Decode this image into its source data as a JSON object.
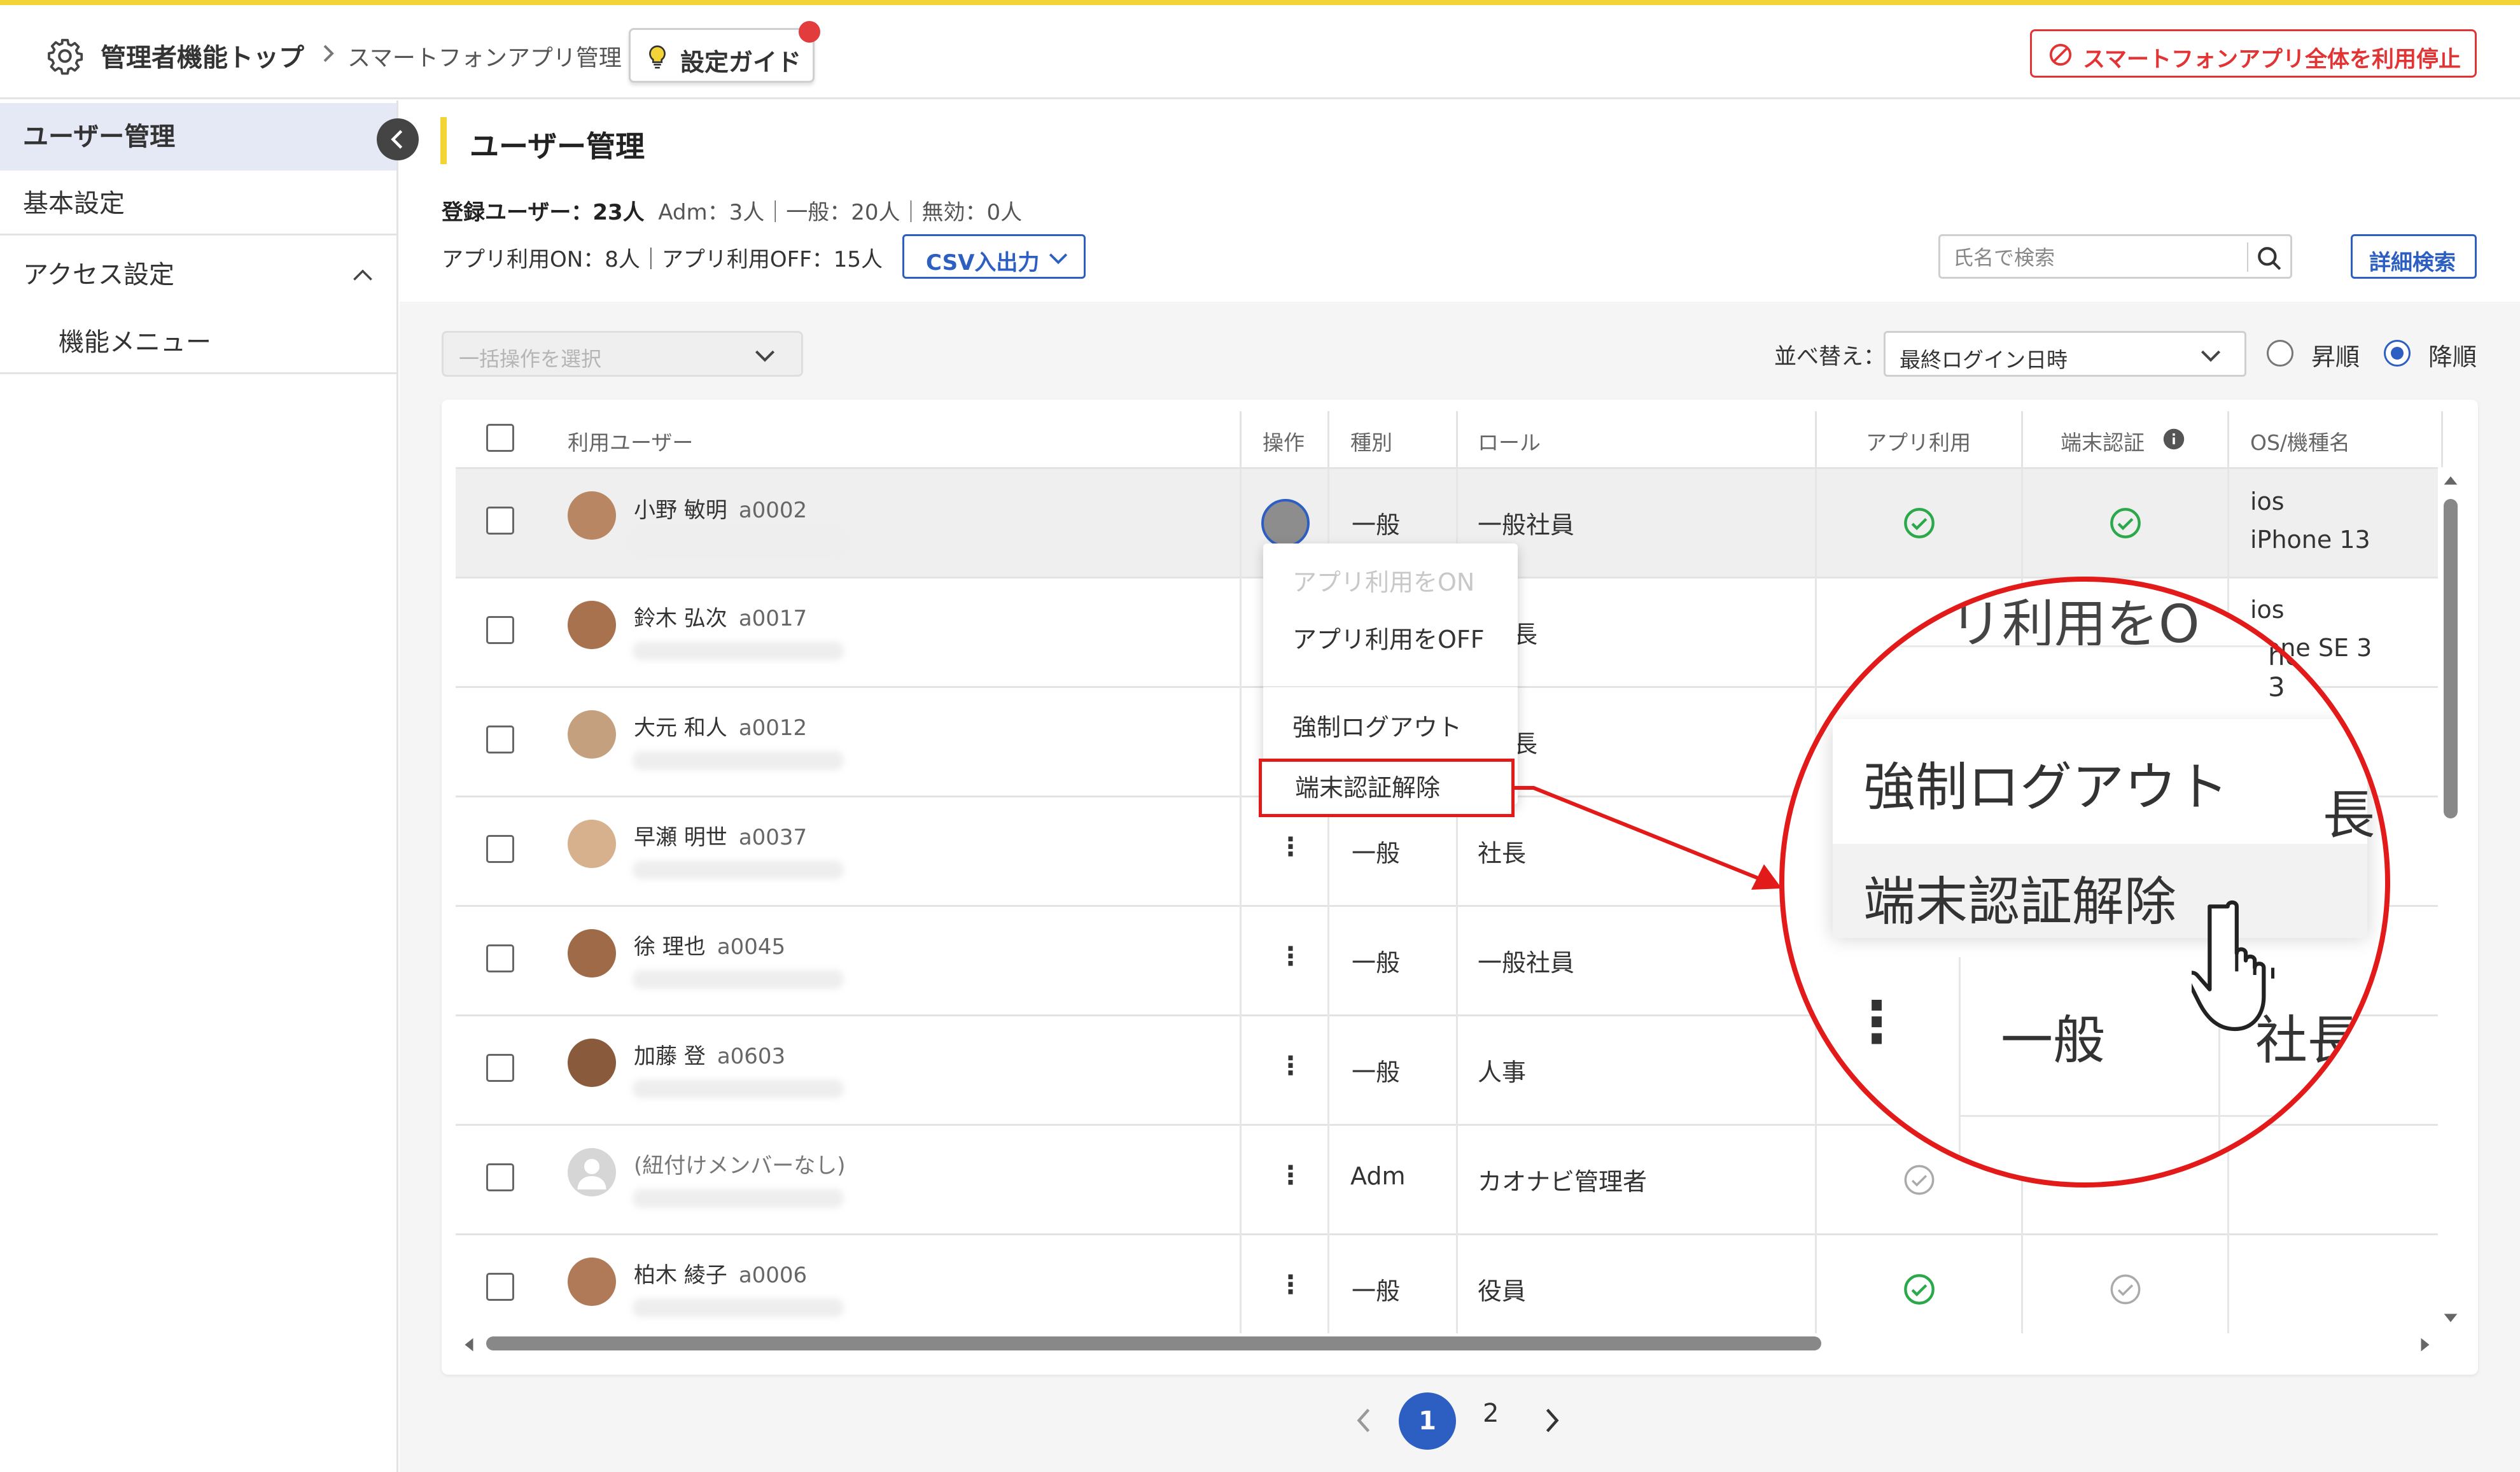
{
  "header": {
    "admin_top": "管理者機能トップ",
    "current_page": "スマートフォンアプリ管理",
    "guide_button": "設定ガイド",
    "stop_button": "スマートフォンアプリ全体を利用停止"
  },
  "sidebar": {
    "user_mgmt": "ユーザー管理",
    "basic_settings": "基本設定",
    "access_settings": "アクセス設定",
    "function_menu": "機能メニュー"
  },
  "main": {
    "title": "ユーザー管理",
    "stats_registered_label": "登録ユーザー：23人",
    "stats_detail": "Adm：3人｜一般：20人｜無効：0人",
    "stats_app": "アプリ利用ON：8人｜アプリ利用OFF：15人",
    "csv_button": "CSV入出力",
    "search_placeholder": "氏名で検索",
    "advanced_search": "詳細検索",
    "bulk_placeholder": "一括操作を選択",
    "sort_label": "並べ替え：",
    "sort_value": "最終ログイン日時",
    "asc": "昇順",
    "desc": "降順"
  },
  "table": {
    "headers": {
      "user": "利用ユーザー",
      "action": "操作",
      "type": "種別",
      "role": "ロール",
      "app_use": "アプリ利用",
      "device_auth": "端末認証",
      "os": "OS/機種名"
    },
    "rows": [
      {
        "name": "小野 敏明",
        "id": "a0002",
        "type": "一般",
        "role": "一般社員",
        "os1": "ios",
        "os2": "iPhone 13"
      },
      {
        "name": "鈴木 弘次",
        "id": "a0017",
        "type": "",
        "role": "長",
        "os1": "ios",
        "os2": "hone SE 3"
      },
      {
        "name": "大元 和人",
        "id": "a0012",
        "type": "",
        "role": "長",
        "os1": "",
        "os2": ""
      },
      {
        "name": "早瀬 明世",
        "id": "a0037",
        "type": "一般",
        "role": "社長",
        "os1": "",
        "os2": ""
      },
      {
        "name": "徐 理也",
        "id": "a0045",
        "type": "一般",
        "role": "一般社員",
        "os1": "",
        "os2": ""
      },
      {
        "name": "加藤 登",
        "id": "a0603",
        "type": "一般",
        "role": "人事",
        "os1": "",
        "os2": ""
      },
      {
        "name": "(紐付けメンバーなし)",
        "id": "",
        "type": "Adm",
        "role": "カオナビ管理者",
        "os1": "",
        "os2": ""
      },
      {
        "name": "柏木 綾子",
        "id": "a0006",
        "type": "一般",
        "role": "役員",
        "os1": "",
        "os2": ""
      }
    ],
    "kebab": "⋮"
  },
  "menu": {
    "app_on": "アプリ利用をON",
    "app_off": "アプリ利用をOFF",
    "force_logout": "強制ログアウト",
    "release_device": "端末認証解除"
  },
  "zoom": {
    "top_text": "リ利用をO",
    "ios": "ios",
    "ios2": "hone SE 3",
    "logout": "強制ログアウト",
    "release": "端末認証解除",
    "cho": "長",
    "kebab": "⋮",
    "ippan": "一般",
    "shacho": "社長"
  },
  "pagination": {
    "current": "1",
    "next_page": "2"
  },
  "colors": {
    "accent": "#2c5fc1",
    "highlight": "#e21a1a",
    "yellow": "#f3d437",
    "check": "#2aa84a"
  }
}
